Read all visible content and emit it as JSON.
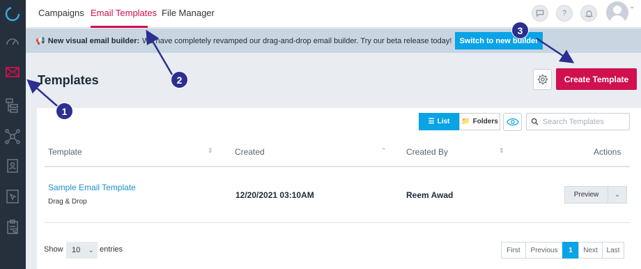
{
  "sidebar": {
    "icons": [
      "logo-ring-icon",
      "speedometer-icon",
      "email-icon",
      "hierarchy-icon",
      "network-icon",
      "contact-card-icon",
      "cursor-window-icon",
      "clipboard-check-icon"
    ],
    "active_color": "#d0104f"
  },
  "topbar": {
    "tabs": [
      {
        "label": "Campaigns"
      },
      {
        "label": "Email Templates"
      },
      {
        "label": "File Manager"
      }
    ],
    "active_tab": "Email Templates",
    "buttons": [
      "chat-icon",
      "help-icon",
      "bell-icon"
    ],
    "help_glyph": "?"
  },
  "banner": {
    "bold_text": "New visual email builder:",
    "text": "We have completely revamped our drag-and-drop email builder. Try our beta release today!",
    "button_label": "Switch to new builder"
  },
  "page": {
    "title": "Templates",
    "create_label": "Create Template"
  },
  "toolbar": {
    "list_label": "List",
    "folders_label": "Folders",
    "search_placeholder": "Search Templates"
  },
  "table": {
    "headers": [
      "Template",
      "Created",
      "Created By",
      "Actions"
    ],
    "rows": [
      {
        "name": "Sample Email Template",
        "type": "Drag & Drop",
        "created": "12/20/2021 03:10AM",
        "created_by": "Reem Awad",
        "action_label": "Preview"
      }
    ]
  },
  "footer": {
    "show_label": "Show",
    "entries_value": "10",
    "entries_label": "entries",
    "pager": [
      "First",
      "Previous",
      "1",
      "Next",
      "Last"
    ],
    "current_page": "1"
  },
  "callouts": [
    "1",
    "2",
    "3"
  ],
  "colors": {
    "accent": "#d0104f",
    "primary_blue": "#0aa3e6",
    "callout": "#2b2f8f",
    "sidebar": "#26303d"
  }
}
